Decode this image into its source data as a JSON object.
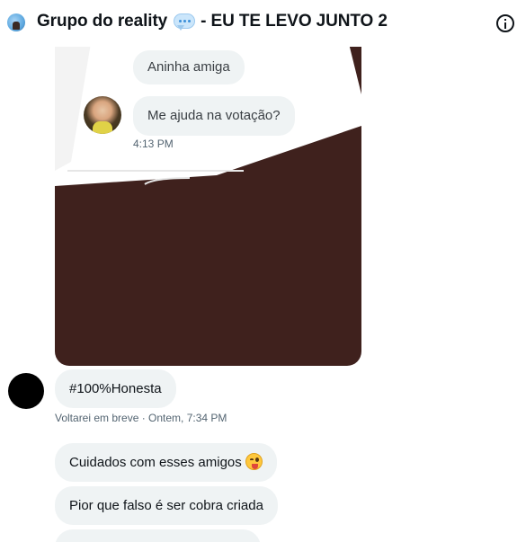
{
  "header": {
    "title_part1": "Grupo do reality",
    "title_part2": "- EU TE LEVO JUNTO 2",
    "emoji_icon": "speech-balloon-icon",
    "info_icon": "info-icon"
  },
  "shared_image": {
    "bubble_1": "Aninha amiga",
    "bubble_2": "Me ajuda na votação?",
    "time": "4:13 PM"
  },
  "messages": {
    "hashtag": "#100%Honesta",
    "meta": "Voltarei em breve · Ontem, 7:34 PM",
    "msg_1": "Cuidados com esses amigos",
    "msg_1_emoji": "winking-face-with-tongue-icon",
    "msg_2": "Pior que falso é ser cobra criada"
  },
  "colors": {
    "bubble_bg": "#eff3f4",
    "image_bg": "#3f211d",
    "meta_text": "#536471"
  }
}
